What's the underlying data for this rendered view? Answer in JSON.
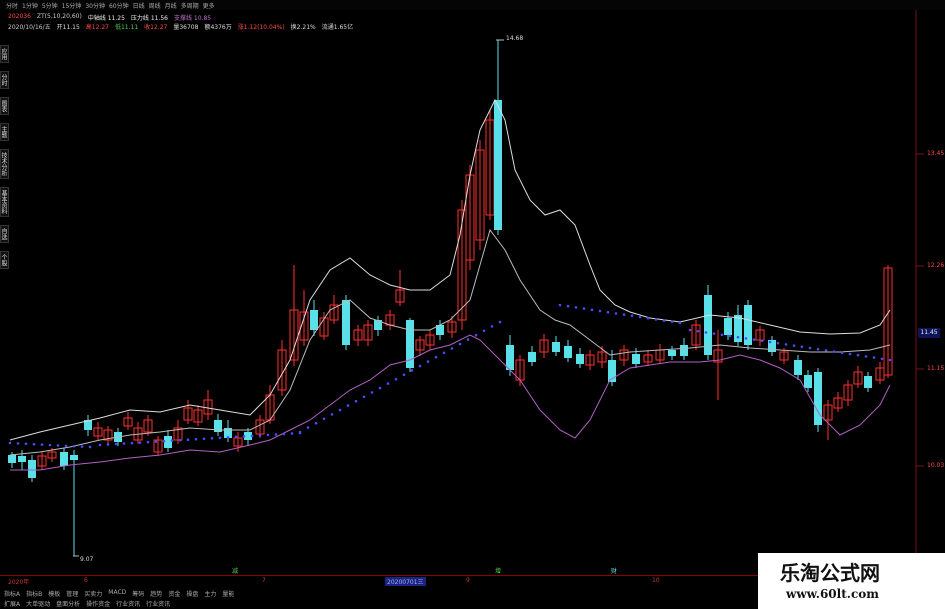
{
  "toolbar": {
    "items": [
      "分时",
      "1分钟",
      "5分钟",
      "15分钟",
      "30分钟",
      "60分钟",
      "日线",
      "周线",
      "月线",
      "多周期",
      "更多"
    ]
  },
  "info_line1": {
    "code": "202036",
    "ma_text": "ZT(5,10,20,60)",
    "mid": "中轴线 11.25",
    "pressure": "压力线 11.56",
    "support": "支撑线 10.85"
  },
  "info_line2": {
    "date": "2020/10/16/五",
    "open": "开11.15",
    "high": "高12.27",
    "low": "低11.11",
    "close": "收12.27",
    "volume": "量36708",
    "amount": "额4376万",
    "change": "涨1.12(10.04%)",
    "turnover": "换2.21%",
    "float": "流通1.65亿"
  },
  "sidebar": [
    "应用",
    "分时",
    "图表",
    "主题",
    "技术分析",
    "基本资料",
    "自选",
    "个股"
  ],
  "price_axis": {
    "p1": "13.45",
    "p2": "12.26",
    "p3": "11.15",
    "p4": "10.03",
    "current": "11.45"
  },
  "annotations": {
    "peak": "14.68",
    "low": "9.07"
  },
  "date_axis": {
    "labels": [
      "2020年",
      "6",
      "7",
      "20200701三",
      "9",
      "10",
      "11"
    ]
  },
  "markers": {
    "m1": "减",
    "m2": "增",
    "m3": "财"
  },
  "tabs_row1": [
    "指标A",
    "指标B",
    "模板",
    "管理",
    "买卖力",
    "MACD",
    "筹码",
    "趋势",
    "资金",
    "操盘",
    "主力",
    "量能"
  ],
  "tabs_row2": [
    "扩展A",
    "大单驱动",
    "盘面分析",
    "操作资金",
    "行业资讯",
    "行业资讯"
  ],
  "watermark": {
    "logo": "乐淘公式网",
    "url": "www.60lt.com"
  },
  "colors": {
    "up": "#ff3030",
    "down": "#59e0e8",
    "bg": "#000000",
    "ma": "#dddddd",
    "dots": "#4b4bff",
    "band": "#b160c4"
  }
}
